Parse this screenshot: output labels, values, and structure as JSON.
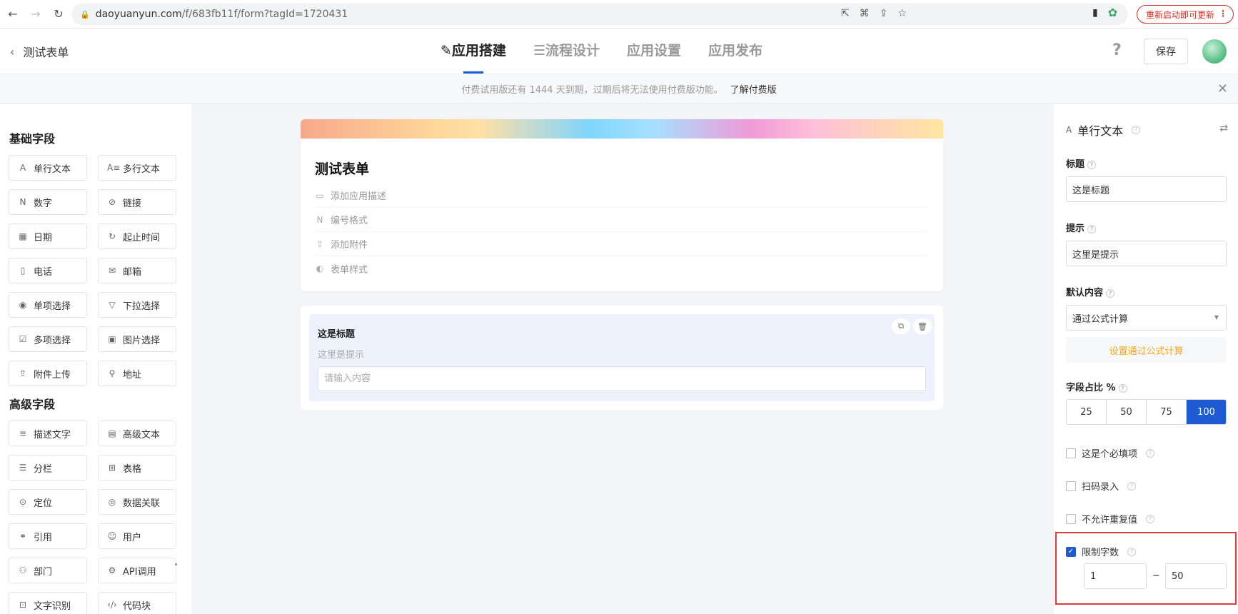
{
  "browser": {
    "url_domain": "daoyuanyun.com",
    "url_path": "/f/683fb11f/form?tagId=1720431",
    "update_label": "重新启动即可更新"
  },
  "header": {
    "back_title": "测试表单",
    "tabs": [
      {
        "label": "应用搭建",
        "icon": "edit-icon"
      },
      {
        "label": "流程设计",
        "icon": "list-icon"
      },
      {
        "label": "应用设置"
      },
      {
        "label": "应用发布"
      }
    ],
    "help": "?",
    "save_label": "保存"
  },
  "notice": {
    "text": "付费试用版还有 1444 天到期，过期后将无法使用付费版功能。",
    "link": "了解付费版"
  },
  "left": {
    "basic_title": "基础字段",
    "basic_fields": [
      {
        "label": "单行文本",
        "icon": "A"
      },
      {
        "label": "多行文本",
        "icon": "A≡"
      },
      {
        "label": "数字",
        "icon": "N"
      },
      {
        "label": "链接",
        "icon": "⊘"
      },
      {
        "label": "日期",
        "icon": "▦"
      },
      {
        "label": "起止时间",
        "icon": "↻"
      },
      {
        "label": "电话",
        "icon": "▯"
      },
      {
        "label": "邮箱",
        "icon": "✉"
      },
      {
        "label": "单项选择",
        "icon": "◉"
      },
      {
        "label": "下拉选择",
        "icon": "▽"
      },
      {
        "label": "多项选择",
        "icon": "☑"
      },
      {
        "label": "图片选择",
        "icon": "▣"
      },
      {
        "label": "附件上传",
        "icon": "⇧"
      },
      {
        "label": "地址",
        "icon": "⚲"
      }
    ],
    "advanced_title": "高级字段",
    "advanced_fields": [
      {
        "label": "描述文字",
        "icon": "≡"
      },
      {
        "label": "高级文本",
        "icon": "▤"
      },
      {
        "label": "分栏",
        "icon": "☰"
      },
      {
        "label": "表格",
        "icon": "⊞"
      },
      {
        "label": "定位",
        "icon": "⊙"
      },
      {
        "label": "数据关联",
        "icon": "◎"
      },
      {
        "label": "引用",
        "icon": "⚭"
      },
      {
        "label": "用户",
        "icon": "☺"
      },
      {
        "label": "部门",
        "icon": "⚇"
      },
      {
        "label": "API调用",
        "icon": "⚙"
      },
      {
        "label": "文字识别",
        "icon": "⊡"
      },
      {
        "label": "代码块",
        "icon": "‹/›"
      }
    ]
  },
  "form": {
    "title": "测试表单",
    "meta": [
      {
        "label": "添加应用描述",
        "icon": "💬"
      },
      {
        "label": "编号格式",
        "icon": "N"
      },
      {
        "label": "添加附件",
        "icon": "⇧"
      },
      {
        "label": "表单样式",
        "icon": "◐"
      }
    ],
    "field": {
      "title": "这是标题",
      "hint": "这里是提示",
      "placeholder": "请输入内容"
    }
  },
  "right": {
    "header": "单行文本",
    "title_label": "标题",
    "title_value": "这是标题",
    "hint_label": "提示",
    "hint_value": "这里是提示",
    "default_label": "默认内容",
    "default_value": "通过公式计算",
    "formula_btn": "设置通过公式计算",
    "ratio_label": "字段占比 %",
    "ratio_options": [
      "25",
      "50",
      "75",
      "100"
    ],
    "ratio_selected": "100",
    "checks": [
      {
        "label": "这是个必填项",
        "checked": false
      },
      {
        "label": "扫码录入",
        "checked": false
      },
      {
        "label": "不允许重复值",
        "checked": false
      },
      {
        "label": "限制字数",
        "checked": true
      }
    ],
    "limit_min": "1",
    "limit_sep": "~",
    "limit_max": "50"
  },
  "colors": {
    "primary": "#1e5bd3",
    "accent": "#f5a623",
    "highlight": "#e53935"
  }
}
